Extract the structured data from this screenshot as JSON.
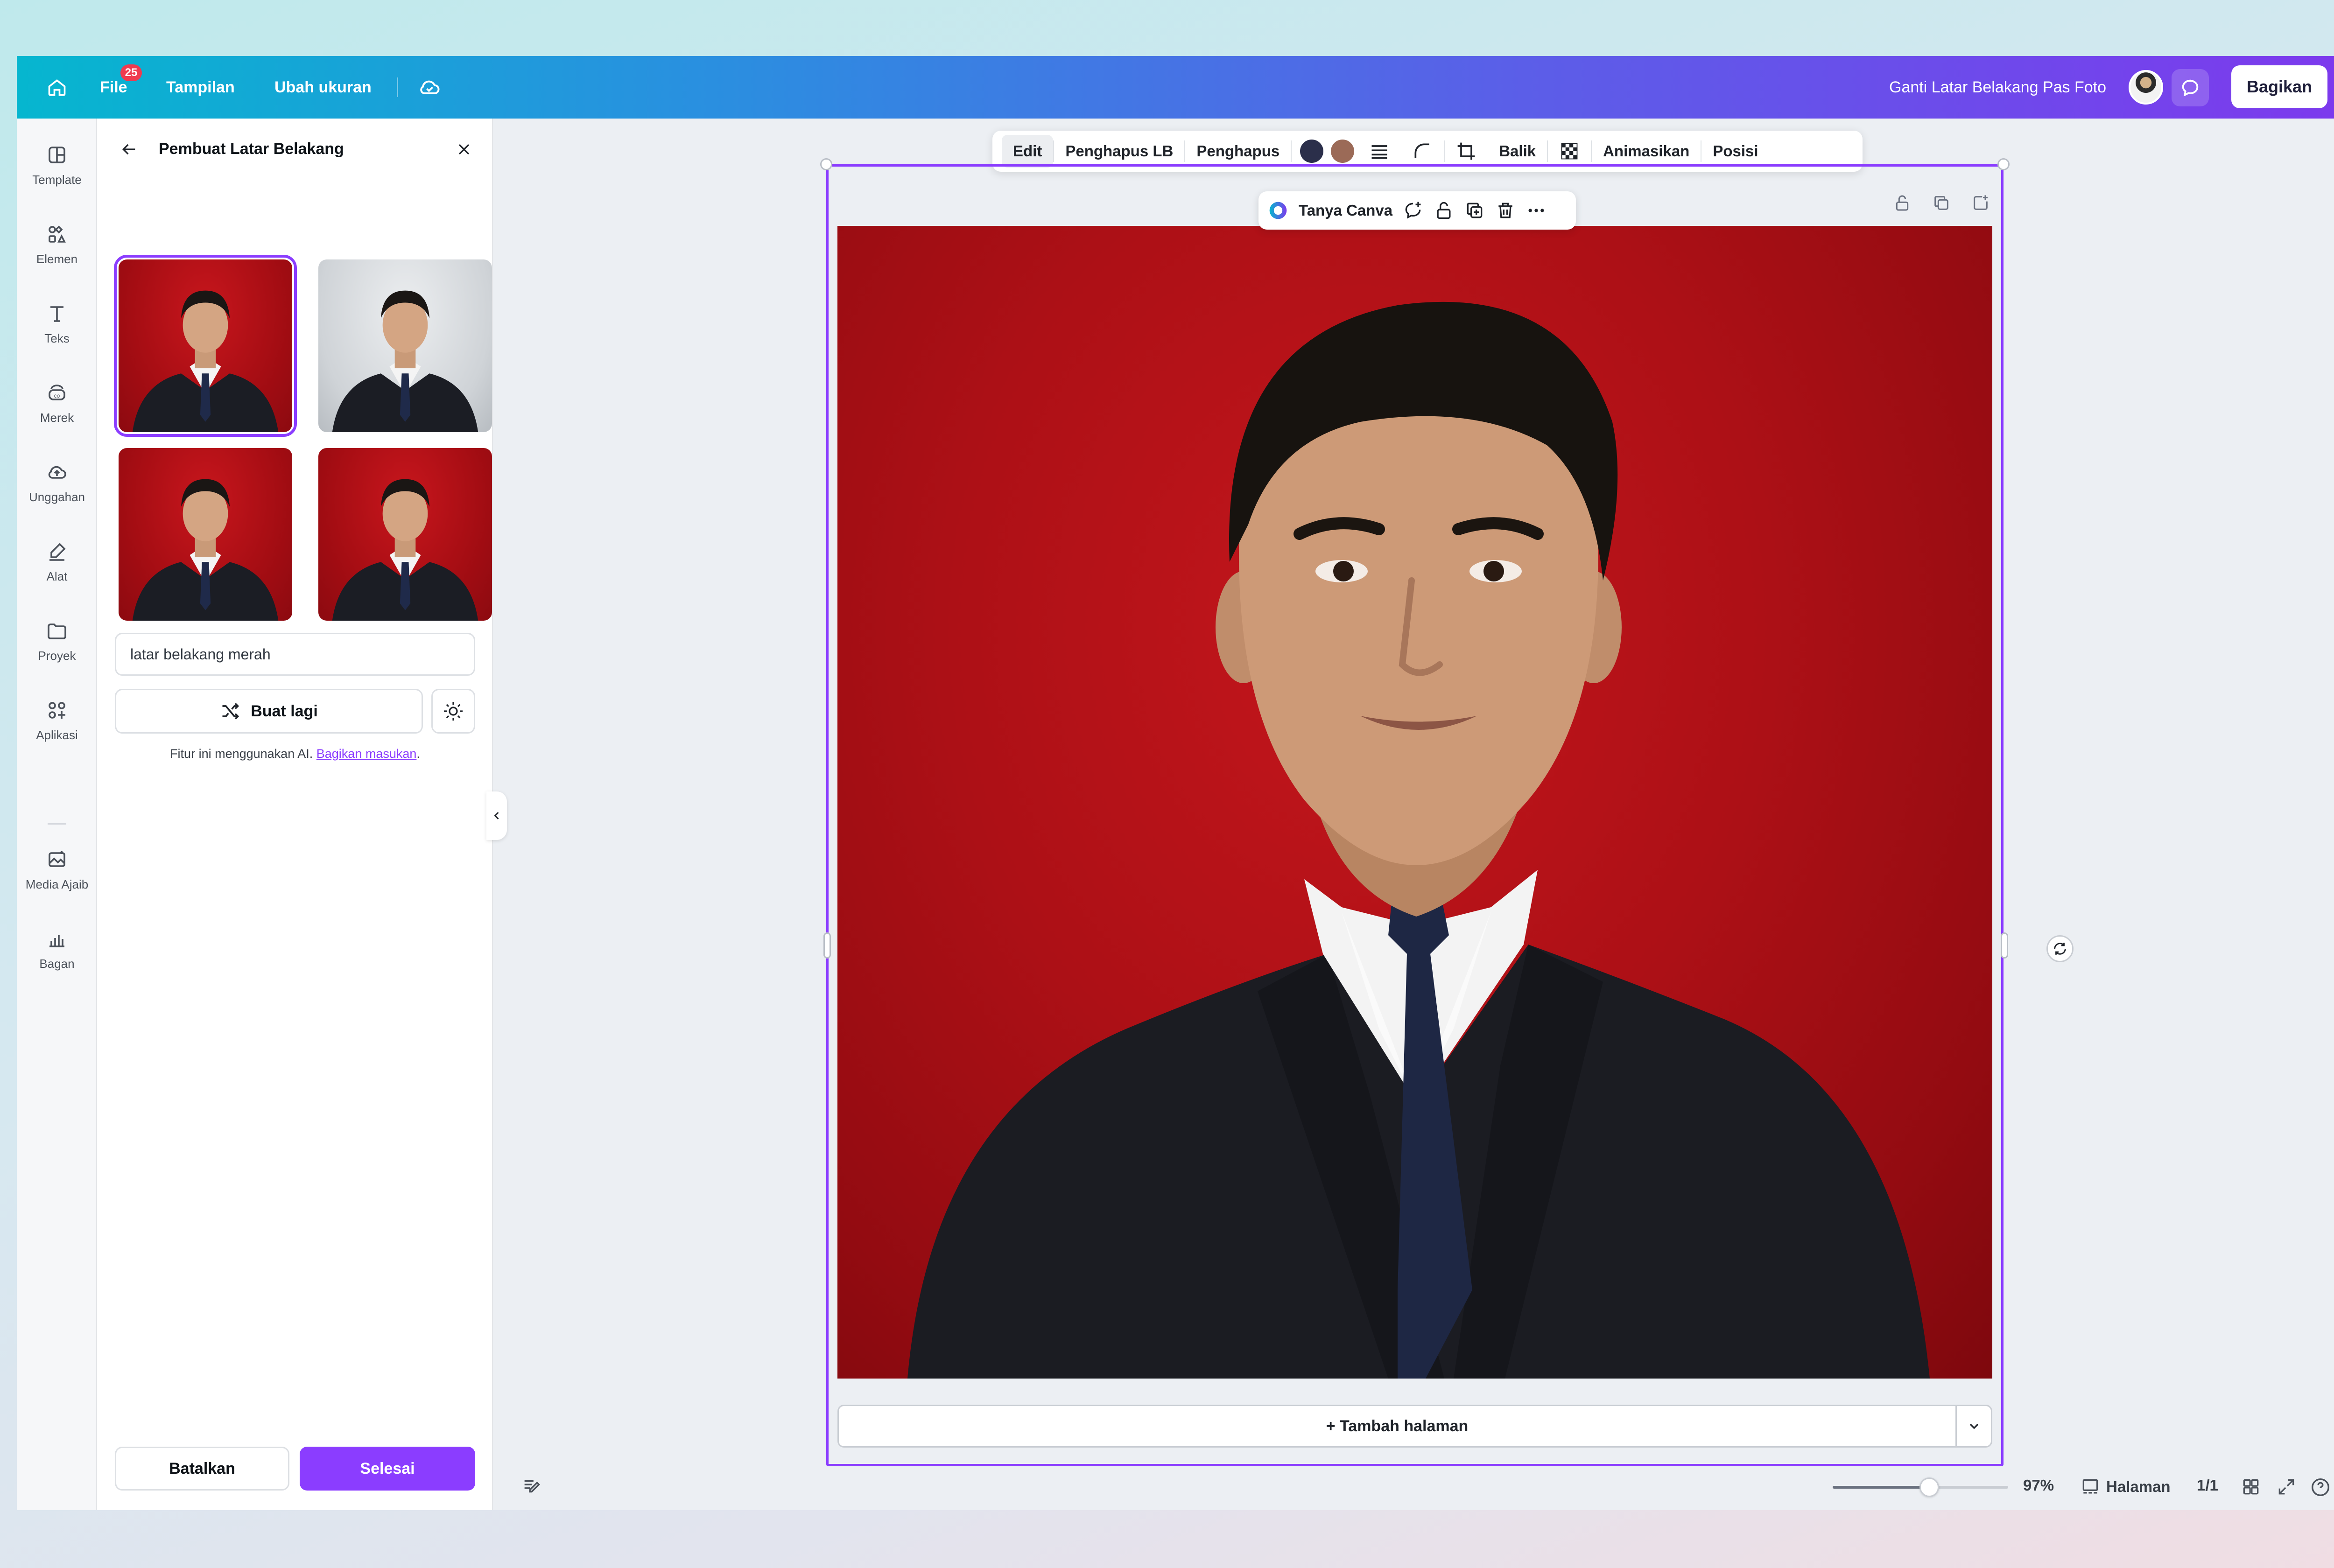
{
  "topbar": {
    "file_label": "File",
    "file_badge": "25",
    "view_label": "Tampilan",
    "resize_label": "Ubah ukuran",
    "document_title": "Ganti Latar Belakang Pas Foto",
    "share_label": "Bagikan",
    "gradient_start": "#06b6cf",
    "gradient_end": "#7c3aed"
  },
  "rail": {
    "items": [
      {
        "label": "Template",
        "icon": "template-icon"
      },
      {
        "label": "Elemen",
        "icon": "elements-icon"
      },
      {
        "label": "Teks",
        "icon": "text-icon"
      },
      {
        "label": "Merek",
        "icon": "brand-icon"
      },
      {
        "label": "Unggahan",
        "icon": "upload-cloud-icon"
      },
      {
        "label": "Alat",
        "icon": "draw-tool-icon"
      },
      {
        "label": "Proyek",
        "icon": "folder-icon"
      },
      {
        "label": "Aplikasi",
        "icon": "apps-icon"
      },
      {
        "label": "Media Ajaib",
        "icon": "magic-media-icon"
      },
      {
        "label": "Bagan",
        "icon": "chart-icon"
      }
    ]
  },
  "panel": {
    "title": "Pembuat Latar Belakang",
    "results": [
      {
        "background": "red",
        "selected": true
      },
      {
        "background": "grey",
        "selected": false
      },
      {
        "background": "red",
        "selected": false
      },
      {
        "background": "red",
        "selected": false
      }
    ],
    "prompt_value": "latar belakang merah",
    "regenerate_label": "Buat lagi",
    "ai_note": "Fitur ini menggunakan AI.",
    "feedback_link": "Bagikan masukan",
    "cancel_label": "Batalkan",
    "done_label": "Selesai"
  },
  "context_toolbar": {
    "edit": "Edit",
    "bg_remover": "Penghapus LB",
    "eraser": "Penghapus",
    "color_1": "#2b2f4a",
    "color_2": "#9b6a57",
    "flip": "Balik",
    "animate": "Animasikan",
    "position": "Posisi"
  },
  "floating_toolbar": {
    "ask_canva": "Tanya Canva"
  },
  "canvas": {
    "add_page_label": "+ Tambah halaman",
    "accent": "#8b3dff"
  },
  "bottom_bar": {
    "zoom_fraction": 0.55,
    "zoom_label": "97%",
    "pages_label": "Halaman",
    "page_count": "1/1"
  }
}
